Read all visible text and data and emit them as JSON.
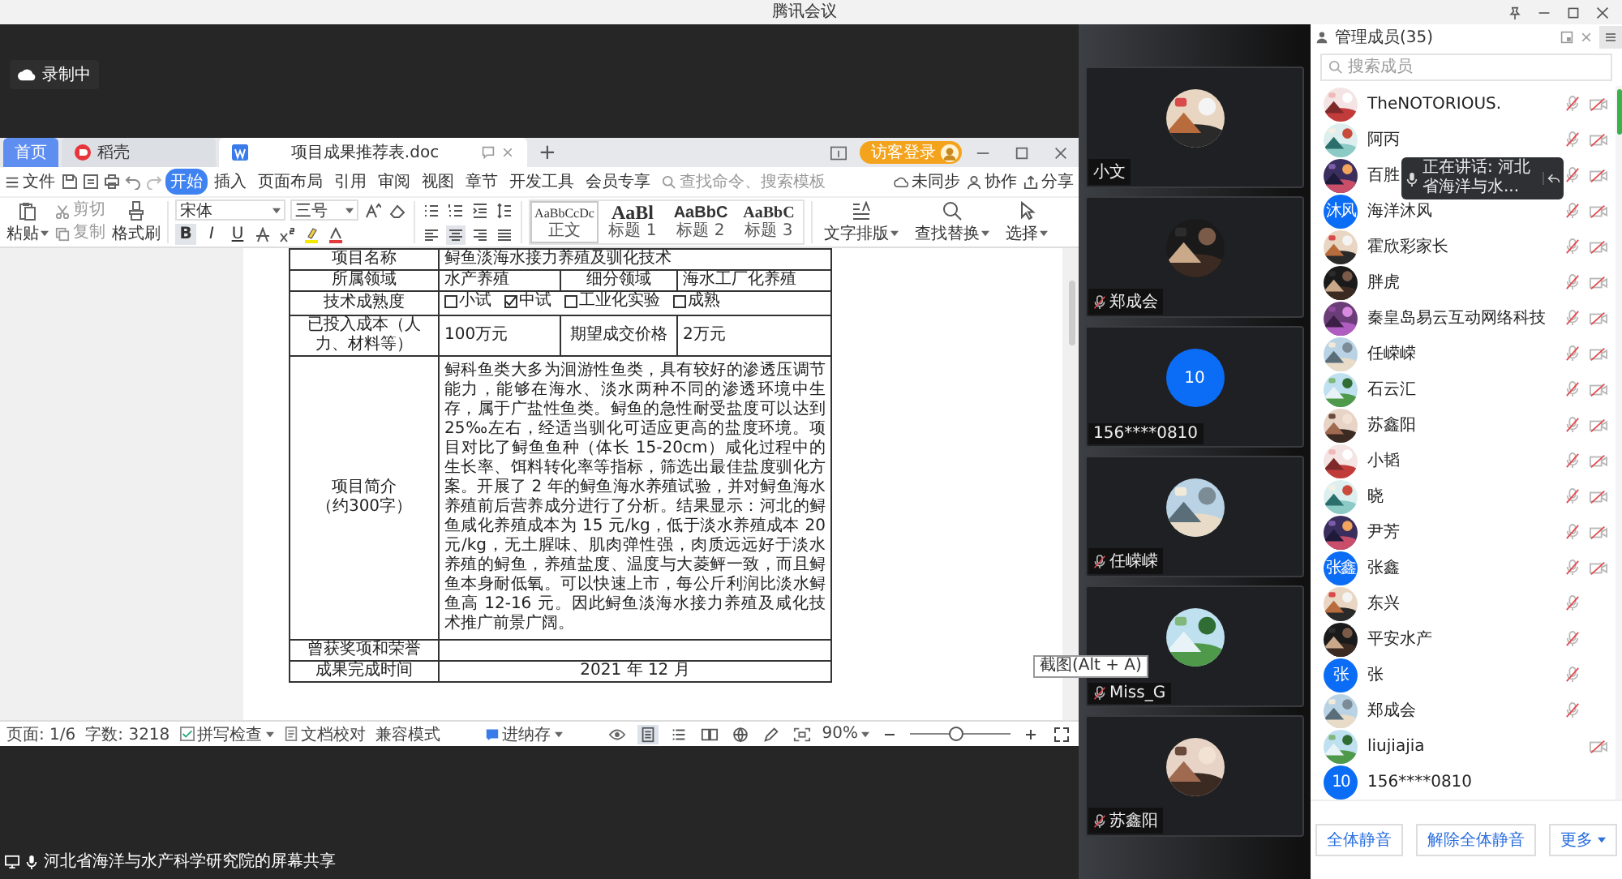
{
  "title_bar": {
    "title": "腾讯会议"
  },
  "recording": {
    "label": "录制中"
  },
  "wps": {
    "tabs": [
      {
        "label": "首页",
        "kind": "home",
        "selected": false
      },
      {
        "label": "稻壳",
        "kind": "docer",
        "selected": false
      },
      {
        "label": "项目成果推荐表.doc",
        "kind": "doc",
        "selected": true
      }
    ],
    "new_tab": "+",
    "login_button": "访客登录",
    "file_menu": "文件",
    "menu_tabs": [
      {
        "label": "开始",
        "selected": true
      },
      {
        "label": "插入",
        "selected": false
      },
      {
        "label": "页面布局",
        "selected": false
      },
      {
        "label": "引用",
        "selected": false
      },
      {
        "label": "审阅",
        "selected": false
      },
      {
        "label": "视图",
        "selected": false
      },
      {
        "label": "章节",
        "selected": false
      },
      {
        "label": "开发工具",
        "selected": false
      },
      {
        "label": "会员专享",
        "selected": false
      }
    ],
    "search_placeholder": "查找命令、搜索模板",
    "actions": [
      {
        "label": "未同步",
        "kind": "sync"
      },
      {
        "label": "协作",
        "kind": "collab"
      },
      {
        "label": "分享",
        "kind": "share"
      }
    ],
    "ribbon": {
      "paste": "粘贴",
      "cut": "剪切",
      "copy": "复制",
      "format_painter": "格式刷",
      "font": "宋体",
      "font_size": "三号",
      "text_styles": [
        {
          "label": "B",
          "on": true
        },
        {
          "label": "I",
          "on": false
        },
        {
          "label": "U",
          "on": false
        }
      ],
      "alignments": [
        {
          "kind": "left",
          "selected": false
        },
        {
          "kind": "center",
          "selected": true
        },
        {
          "kind": "right",
          "selected": false
        },
        {
          "kind": "justify",
          "selected": false
        }
      ],
      "styles": [
        {
          "preview": "AaBbCcDc",
          "name": "正文",
          "kind": "body",
          "selected": true
        },
        {
          "preview": "AaBl",
          "name": "标题 1",
          "kind": "h1",
          "selected": false
        },
        {
          "preview": "AaBbC",
          "name": "标题 2",
          "kind": "h2",
          "selected": false
        },
        {
          "preview": "AaBbC",
          "name": "标题 3",
          "kind": "h3",
          "selected": false
        }
      ],
      "tools": [
        {
          "label": "文字排版",
          "kind": "layout"
        },
        {
          "label": "查找替换",
          "kind": "find"
        },
        {
          "label": "选择",
          "kind": "select"
        }
      ]
    },
    "table": {
      "rows": [
        {
          "kind": "pair",
          "label": "项目名称",
          "value": "鲟鱼淡海水接力养殖及驯化技术"
        },
        {
          "kind": "quad",
          "cells": [
            "所属领域",
            "水产养殖",
            "细分领域",
            "海水工厂化养殖"
          ]
        },
        {
          "kind": "options",
          "label": "技术成熟度",
          "options": [
            {
              "label": "小试",
              "checked": false
            },
            {
              "label": "中试",
              "checked": true
            },
            {
              "label": "工业化实验",
              "checked": false
            },
            {
              "label": "成熟",
              "checked": false
            }
          ]
        },
        {
          "kind": "quad",
          "cells": [
            "已投入成本（人力、材料等）",
            "100万元",
            "期望成交价格",
            "2万元"
          ]
        },
        {
          "kind": "paragraph",
          "label": "项目简介",
          "sublabel": "（约300字）",
          "value": "鲟科鱼类大多为洄游性鱼类，具有较好的渗透压调节能力，能够在海水、淡水两种不同的渗透环境中生存，属于广盐性鱼类。鲟鱼的急性耐受盐度可以达到 25‰左右，经适当驯化可适应更高的盐度环境。项目对比了鲟鱼鱼种（体长 15-20cm）咸化过程中的生长率、饵料转化率等指标，筛选出最佳盐度驯化方案。开展了 2 年的鲟鱼海水养殖试验，并对鲟鱼海水养殖前后营养成分进行了分析。结果显示：河北的鲟鱼咸化养殖成本为 15 元/kg，低于淡水养殖成本 20 元/kg，无土腥味、肌肉弹性强，肉质远远好于淡水养殖的鲟鱼，养殖盐度、温度与大菱鲆一致，而且鲟鱼本身耐低氧。可以快速上市，每公斤利润比淡水鲟鱼高 12-16 元。因此鲟鱼淡海水接力养殖及咸化技术推广前景广阔。"
        },
        {
          "kind": "pair",
          "label": "曾获奖项和荣誉"
        },
        {
          "kind": "pair_center",
          "label": "成果完成时间",
          "value": "2021 年 12 月"
        }
      ]
    },
    "status_bar": {
      "page": "页面: 1/6",
      "words": "字数: 3218",
      "spell_check": "拼写检查",
      "proofread": "文档校对",
      "compat_mode": "兼容模式",
      "save": "进纳存",
      "views": [
        {
          "kind": "page",
          "selected": true
        },
        {
          "kind": "outline",
          "selected": false
        },
        {
          "kind": "read",
          "selected": false
        },
        {
          "kind": "web",
          "selected": false
        },
        {
          "kind": "write",
          "selected": false
        }
      ],
      "zoom": "90%",
      "zoom_slider": {
        "level": 0.45
      }
    },
    "tooltip": "截图(Alt + A)"
  },
  "share_label": "河北省海洋与水产科学研究院的屏幕共享",
  "video_tiles": [
    {
      "name": "小文",
      "kind": "picture",
      "muted": false
    },
    {
      "name": "郑成会",
      "kind": "picture",
      "muted": true
    },
    {
      "name": "156****0810",
      "kind": "initials",
      "avatar_text": "10",
      "muted": false
    },
    {
      "name": "任嵘嵘",
      "kind": "picture",
      "muted": true
    },
    {
      "name": "Miss_G",
      "kind": "picture",
      "muted": true
    },
    {
      "name": "苏鑫阳",
      "kind": "picture",
      "muted": true
    }
  ],
  "member_panel": {
    "title": "管理成员(35)",
    "search_placeholder": "搜索成员",
    "speaking": {
      "text": "正在讲话: 河北省海洋与水..."
    },
    "members": [
      {
        "name": "TheNOTORIOUS.",
        "kind": "picture",
        "mic_muted": true,
        "camera_off": true
      },
      {
        "name": "阿丙",
        "kind": "picture",
        "mic_muted": true,
        "camera_off": true
      },
      {
        "name": "百胜",
        "kind": "picture",
        "mic_muted": true,
        "camera_off": true
      },
      {
        "name": "海洋沐风",
        "kind": "initials",
        "avatar_text": "沐风",
        "mic_muted": true,
        "camera_off": true
      },
      {
        "name": "霍欣彩家长",
        "kind": "picture",
        "mic_muted": true,
        "camera_off": true
      },
      {
        "name": "胖虎",
        "kind": "picture",
        "mic_muted": true,
        "camera_off": true
      },
      {
        "name": "秦皇岛易云互动网络科技",
        "kind": "picture",
        "mic_muted": true,
        "camera_off": true
      },
      {
        "name": "任嵘嵘",
        "kind": "picture",
        "mic_muted": true,
        "camera_off": true
      },
      {
        "name": "石云汇",
        "kind": "picture",
        "mic_muted": true,
        "camera_off": true
      },
      {
        "name": "苏鑫阳",
        "kind": "picture",
        "mic_muted": true,
        "camera_off": true
      },
      {
        "name": "小韬",
        "kind": "picture",
        "mic_muted": true,
        "camera_off": true
      },
      {
        "name": "晓",
        "kind": "picture",
        "mic_muted": true,
        "camera_off": true
      },
      {
        "name": "尹芳",
        "kind": "picture",
        "mic_muted": true,
        "camera_off": true
      },
      {
        "name": "张鑫",
        "kind": "initials",
        "avatar_text": "张鑫",
        "mic_muted": true,
        "camera_off": true
      },
      {
        "name": "东兴",
        "kind": "picture",
        "mic_muted": true,
        "camera_off": false
      },
      {
        "name": "平安水产",
        "kind": "picture",
        "mic_muted": true,
        "camera_off": false
      },
      {
        "name": "张",
        "kind": "initials",
        "avatar_text": "张",
        "mic_muted": true,
        "camera_off": false
      },
      {
        "name": "郑成会",
        "kind": "picture",
        "mic_muted": true,
        "camera_off": false
      },
      {
        "name": "liujiajia",
        "kind": "picture",
        "mic_muted": false,
        "camera_off": true
      },
      {
        "name": "156****0810",
        "kind": "initials",
        "avatar_text": "10",
        "mic_muted": false,
        "camera_off": false
      }
    ],
    "buttons": [
      {
        "label": "全体静音",
        "kind": "plain"
      },
      {
        "label": "解除全体静音",
        "kind": "plain"
      },
      {
        "label": "更多",
        "kind": "menu"
      }
    ]
  }
}
